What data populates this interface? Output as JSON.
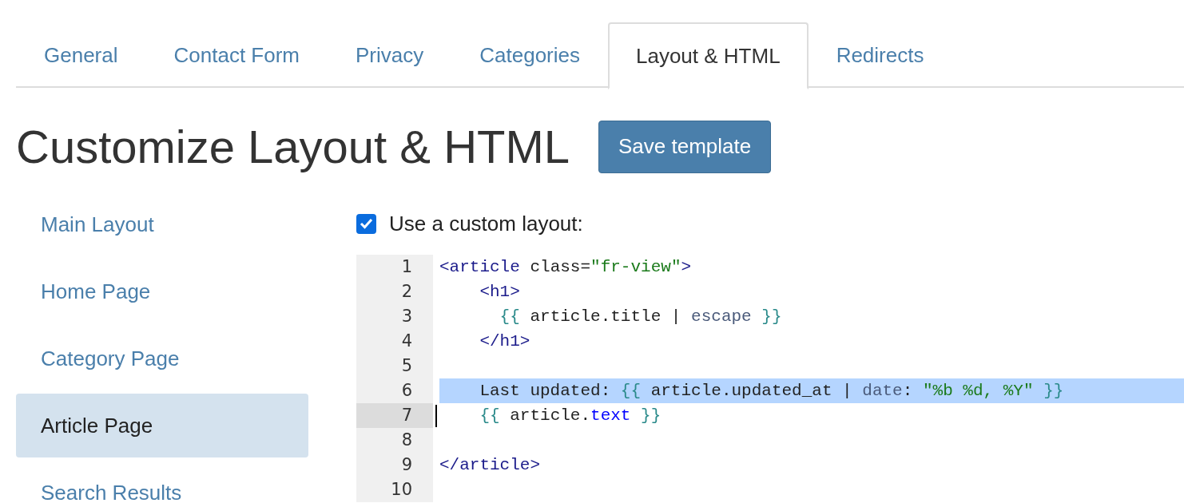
{
  "tabs": [
    {
      "label": "General",
      "selected": false
    },
    {
      "label": "Contact Form",
      "selected": false
    },
    {
      "label": "Privacy",
      "selected": false
    },
    {
      "label": "Categories",
      "selected": false
    },
    {
      "label": "Layout & HTML",
      "selected": true
    },
    {
      "label": "Redirects",
      "selected": false
    }
  ],
  "heading": "Customize Layout & HTML",
  "save_button": "Save template",
  "sidebar": {
    "items": [
      {
        "label": "Main Layout",
        "selected": false
      },
      {
        "label": "Home Page",
        "selected": false
      },
      {
        "label": "Category Page",
        "selected": false
      },
      {
        "label": "Article Page",
        "selected": true
      },
      {
        "label": "Search Results",
        "selected": false
      }
    ]
  },
  "custom_layout": {
    "label": "Use a custom layout:",
    "checked": true
  },
  "editor": {
    "lines": [
      {
        "number": "1",
        "highlighted": false,
        "cursor": false,
        "tokens": [
          {
            "kind": "tag",
            "text": "<article"
          },
          {
            "kind": "attr",
            "text": " class"
          },
          {
            "kind": "plain",
            "text": "="
          },
          {
            "kind": "string",
            "text": "\"fr-view\""
          },
          {
            "kind": "tag",
            "text": ">"
          }
        ]
      },
      {
        "number": "2",
        "highlighted": false,
        "cursor": false,
        "tokens": [
          {
            "kind": "tag",
            "text": "    <h1>"
          }
        ]
      },
      {
        "number": "3",
        "highlighted": false,
        "cursor": false,
        "tokens": [
          {
            "kind": "brace",
            "text": "      {{"
          },
          {
            "kind": "plain",
            "text": " article.title | "
          },
          {
            "kind": "filter",
            "text": "escape"
          },
          {
            "kind": "brace",
            "text": " }}"
          }
        ]
      },
      {
        "number": "4",
        "highlighted": false,
        "cursor": false,
        "tokens": [
          {
            "kind": "tag",
            "text": "    </h1>"
          }
        ]
      },
      {
        "number": "5",
        "highlighted": false,
        "cursor": false
      },
      {
        "number": "6",
        "highlighted": true,
        "cursor": false,
        "tokens": [
          {
            "kind": "plain",
            "text": "    Last updated: "
          },
          {
            "kind": "brace",
            "text": "{{"
          },
          {
            "kind": "plain",
            "text": " article.updated_at | "
          },
          {
            "kind": "filter",
            "text": "date"
          },
          {
            "kind": "plain",
            "text": ": "
          },
          {
            "kind": "string",
            "text": "\"%b %d, %Y\""
          },
          {
            "kind": "brace",
            "text": " }}"
          }
        ]
      },
      {
        "number": "7",
        "highlighted": false,
        "cursor": true,
        "tokens": [
          {
            "kind": "brace",
            "text": "    {{"
          },
          {
            "kind": "plain",
            "text": " article."
          },
          {
            "kind": "prop",
            "text": "text"
          },
          {
            "kind": "brace",
            "text": " }}"
          }
        ]
      },
      {
        "number": "8",
        "highlighted": false,
        "cursor": false
      },
      {
        "number": "9",
        "highlighted": false,
        "cursor": false,
        "tokens": [
          {
            "kind": "tag",
            "text": "</article>"
          }
        ]
      },
      {
        "number": "10",
        "highlighted": false,
        "cursor": false
      }
    ]
  }
}
